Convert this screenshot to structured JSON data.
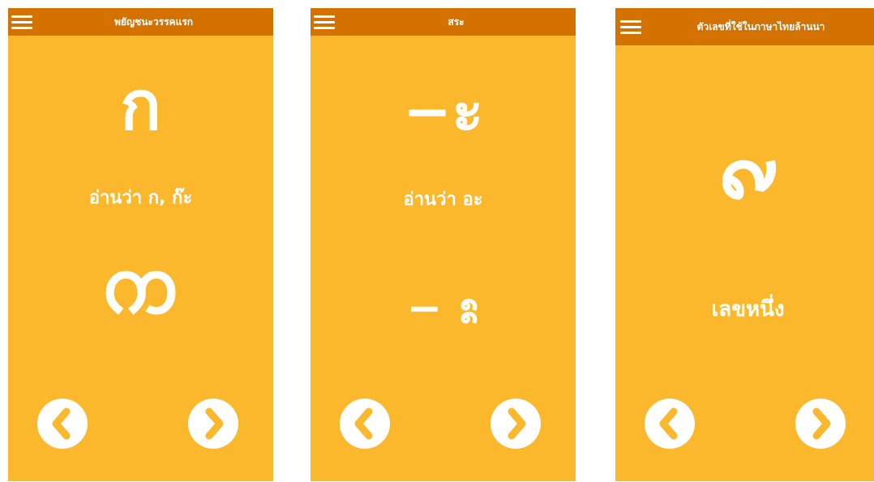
{
  "screens": [
    {
      "title": "พยัญชนะวรรคแรก",
      "glyph": "ก",
      "caption": "อ่านว่า  ก, ก๊ะ",
      "lanna_glyph": "ᨠ"
    },
    {
      "title": "สระ",
      "glyph": "−ะ",
      "caption": "อ่านว่า  อะ",
      "lanna_glyph": "−  ᩡ"
    },
    {
      "title": "ตัวเลขที่ใช้ในภาษาไทยล้านนา",
      "glyph": "᪑",
      "caption": "เลขหนึ่ง"
    }
  ],
  "icons": {
    "menu": "hamburger-menu-icon",
    "prev": "chevron-left-icon",
    "next": "chevron-right-icon"
  },
  "colors": {
    "background": "#fbb82d",
    "appbar": "#d37200",
    "foreground": "#ffffff",
    "icon": "#fbb82d"
  }
}
